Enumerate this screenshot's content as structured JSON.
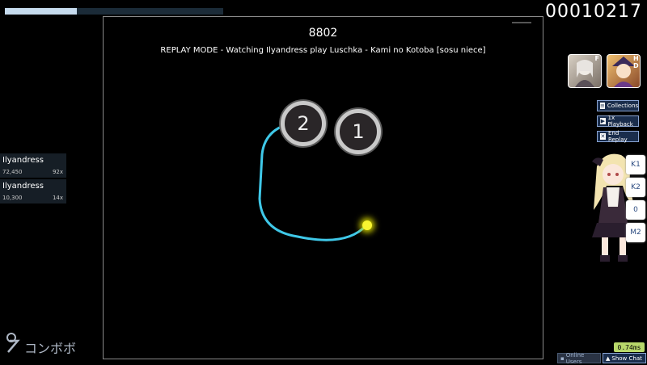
{
  "hud": {
    "health": 0.33,
    "score": "00010217"
  },
  "playfield": {
    "combo": "8802",
    "replay_message": "REPLAY MODE - Watching Ilyandress play Luschka - Kami no Kotoba [sosu niece]",
    "circles": [
      {
        "number": "2"
      },
      {
        "number": "1"
      }
    ]
  },
  "leaderboard": [
    {
      "name": "Ilyandress",
      "score": "72,450",
      "combo": "92x"
    },
    {
      "name": "Ilyandress",
      "score": "10,300",
      "combo": "14x"
    }
  ],
  "logo": {
    "text": "コンボボ"
  },
  "mods": [
    {
      "letter": "F",
      "color": "#d8d0c4"
    },
    {
      "letter": "H D",
      "color": "#e0a040"
    }
  ],
  "side_buttons": {
    "collections": "Collections",
    "playback": "1x Playback",
    "end_replay": "End Replay"
  },
  "keys": [
    "K1",
    "K2",
    "0",
    "M2"
  ],
  "latency": "0.74ms",
  "bottom": {
    "online_users": "Online Users",
    "show_chat": "Show Chat"
  },
  "colors": {
    "slider_path": "#3fc8e8",
    "cursor": "#f8f530",
    "accent": "#8aa5d4"
  }
}
